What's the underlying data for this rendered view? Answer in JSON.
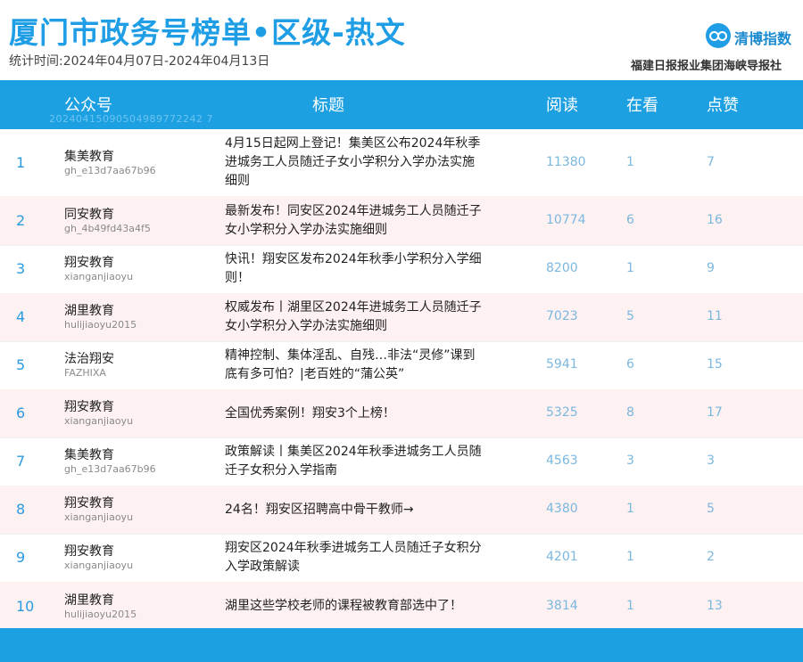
{
  "header": {
    "title": "厦门市政务号榜单•区级-热文",
    "period": "统计时间:2024年04月07日-2024年04月13日",
    "logo_text": "清博指数",
    "publisher": "福建日报报业集团海峡导报社"
  },
  "table": {
    "columns": [
      "公众号",
      "标题",
      "阅读",
      "在看",
      "点赞"
    ],
    "header_id": "20240415090504989772242 7",
    "rows": [
      {
        "rank": "1",
        "account": "集美教育",
        "account_id": "gh_e13d7aa67b96",
        "title": "4月15日起网上登记！集美区公布2024年秋季进城务工人员随迁子女小学积分入学办法实施细则",
        "reads": "11380",
        "looking": "1",
        "likes": "7"
      },
      {
        "rank": "2",
        "account": "同安教育",
        "account_id": "gh_4b49fd43a4f5",
        "title": "最新发布！同安区2024年进城务工人员随迁子女小学积分入学办法实施细则",
        "reads": "10774",
        "looking": "6",
        "likes": "16"
      },
      {
        "rank": "3",
        "account": "翔安教育",
        "account_id": "xianganjiaoyu",
        "title": "快讯！翔安区发布2024年秋季小学积分入学细则！",
        "reads": "8200",
        "looking": "1",
        "likes": "9"
      },
      {
        "rank": "4",
        "account": "湖里教育",
        "account_id": "hulijiaoyu2015",
        "title": "权威发布丨湖里区2024年进城务工人员随迁子女小学积分入学办法实施细则",
        "reads": "7023",
        "looking": "5",
        "likes": "11"
      },
      {
        "rank": "5",
        "account": "法治翔安",
        "account_id": "FAZHIXA",
        "title": "精神控制、集体淫乱、自残…非法“灵修”课到底有多可怕？|老百姓的“蒲公英”",
        "reads": "5941",
        "looking": "6",
        "likes": "15"
      },
      {
        "rank": "6",
        "account": "翔安教育",
        "account_id": "xianganjiaoyu",
        "title": "全国优秀案例！翔安3个上榜！",
        "reads": "5325",
        "looking": "8",
        "likes": "17"
      },
      {
        "rank": "7",
        "account": "集美教育",
        "account_id": "gh_e13d7aa67b96",
        "title": "政策解读丨集美区2024年秋季进城务工人员随迁子女积分入学指南",
        "reads": "4563",
        "looking": "3",
        "likes": "3"
      },
      {
        "rank": "8",
        "account": "翔安教育",
        "account_id": "xianganjiaoyu",
        "title": "24名！翔安区招聘高中骨干教师→",
        "reads": "4380",
        "looking": "1",
        "likes": "5"
      },
      {
        "rank": "9",
        "account": "翔安教育",
        "account_id": "xianganjiaoyu",
        "title": "翔安区2024年秋季进城务工人员随迁子女积分入学政策解读",
        "reads": "4201",
        "looking": "1",
        "likes": "2"
      },
      {
        "rank": "10",
        "account": "湖里教育",
        "account_id": "hulijiaoyu2015",
        "title": "湖里这些学校老师的课程被教育部选中了！",
        "reads": "3814",
        "looking": "1",
        "likes": "13"
      }
    ]
  }
}
